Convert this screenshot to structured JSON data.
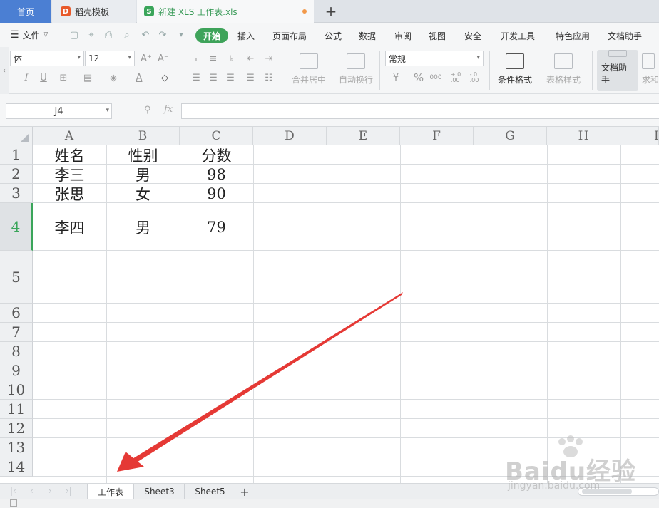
{
  "tabs": {
    "home": "首页",
    "docer": "稻壳模板",
    "file": "新建 XLS 工作表.xls",
    "add": "+"
  },
  "menu": {
    "file_label": "文件",
    "tabs": [
      "开始",
      "插入",
      "页面布局",
      "公式",
      "数据",
      "审阅",
      "视图",
      "安全",
      "开发工具",
      "特色应用",
      "文档助手"
    ]
  },
  "ribbon": {
    "font_name": "体",
    "font_size": "12",
    "number_format": "常规",
    "merge_center": "合并居中",
    "auto_wrap": "自动换行",
    "conditional_format": "条件格式",
    "table_style": "表格样式",
    "doc_assistant": "文档助手",
    "sum_partial": "求和",
    "percent": "%",
    "thousand": "000",
    "inc_decimal": "+.0\n.00",
    "dec_decimal": "-.0\n.00"
  },
  "formula_bar": {
    "name_box": "J4",
    "fx": "fx",
    "formula": ""
  },
  "grid": {
    "columns": [
      "A",
      "B",
      "C",
      "D",
      "E",
      "F",
      "G",
      "H",
      "I"
    ],
    "rows": [
      "1",
      "2",
      "3",
      "4",
      "5",
      "6",
      "7",
      "8",
      "9",
      "10",
      "11",
      "12",
      "13",
      "14"
    ],
    "active_row": "4",
    "cells": [
      [
        "姓名",
        "性别",
        "分数"
      ],
      [
        "李三",
        "男",
        "98"
      ],
      [
        "张思",
        "女",
        "90"
      ],
      [
        "李四",
        "男",
        "79"
      ]
    ]
  },
  "sheets": {
    "tabs": [
      "工作表",
      "Sheet3",
      "Sheet5"
    ],
    "active": "工作表",
    "add": "+"
  },
  "watermark": {
    "brand": "Baidu经验",
    "url": "jingyan.baidu.com"
  },
  "colors": {
    "accent_green": "#3ea35a",
    "home_tab_blue": "#4b7fd3",
    "annotation_red": "#e53935"
  }
}
